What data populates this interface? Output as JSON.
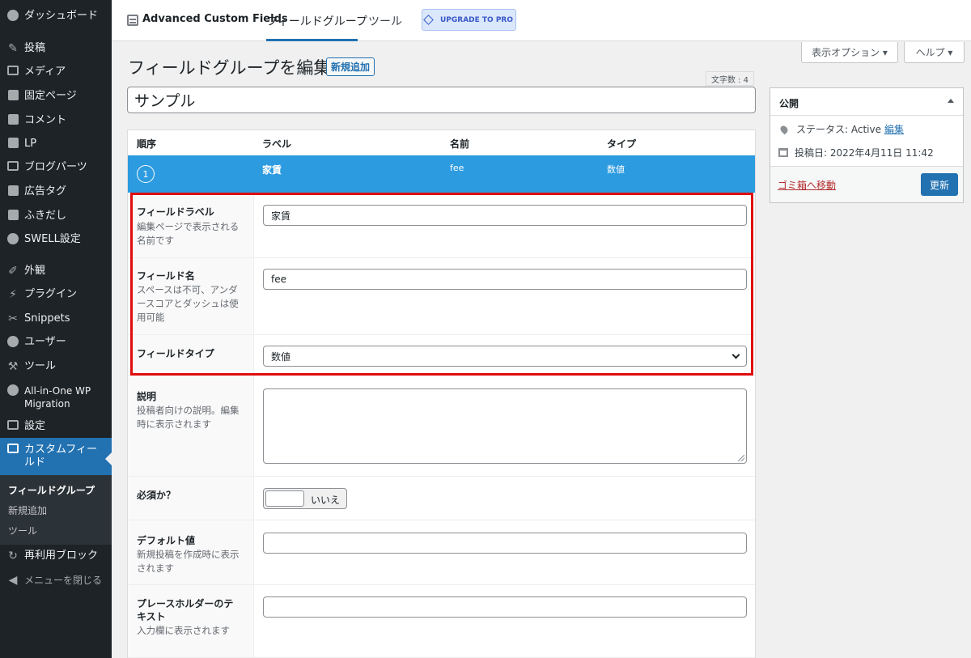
{
  "sidebar": {
    "items": [
      {
        "label": "ダッシュボード",
        "icon": "dashboard-icon"
      },
      {
        "label": "投稿",
        "icon": "pin-icon"
      },
      {
        "label": "メディア",
        "icon": "media-icon"
      },
      {
        "label": "固定ページ",
        "icon": "page-icon"
      },
      {
        "label": "コメント",
        "icon": "comment-icon"
      },
      {
        "label": "LP",
        "icon": "page-icon"
      },
      {
        "label": "ブログパーツ",
        "icon": "table-icon"
      },
      {
        "label": "広告タグ",
        "icon": "megaphone-icon"
      },
      {
        "label": "ふきだし",
        "icon": "speech-bubble-icon"
      },
      {
        "label": "SWELL設定",
        "icon": "swell-icon"
      },
      {
        "label": "外観",
        "icon": "brush-icon"
      },
      {
        "label": "プラグイン",
        "icon": "plugin-icon"
      },
      {
        "label": "Snippets",
        "icon": "scissors-icon"
      },
      {
        "label": "ユーザー",
        "icon": "user-icon"
      },
      {
        "label": "ツール",
        "icon": "wrench-icon"
      },
      {
        "label": "All-in-One WP Migration",
        "icon": "migration-icon"
      },
      {
        "label": "設定",
        "icon": "settings-icon"
      },
      {
        "label": "カスタムフィールド",
        "icon": "custom-fields-icon"
      }
    ],
    "submenu": [
      "フィールドグループ",
      "新規追加",
      "ツール"
    ],
    "reusable_blocks": "再利用ブロック",
    "collapse": "メニューを閉じる"
  },
  "header": {
    "plugin_name": "Advanced Custom Fields",
    "tabs": [
      "フィールドグループ",
      "ツール"
    ],
    "upgrade": "UPGRADE TO PRO"
  },
  "screen_options": {
    "display": "表示オプション ▾",
    "help": "ヘルプ ▾"
  },
  "page": {
    "title": "フィールドグループを編集",
    "add_new": "新規追加",
    "char_count": "文字数 : 4",
    "group_title": "サンプル"
  },
  "fields_table": {
    "headers": [
      "順序",
      "ラベル",
      "名前",
      "タイプ"
    ],
    "row": {
      "order": "1",
      "label": "家賃",
      "name": "fee",
      "type": "数値"
    }
  },
  "settings": {
    "label": {
      "title": "フィールドラベル",
      "desc": "編集ページで表示される名前です",
      "value": "家賃"
    },
    "name": {
      "title": "フィールド名",
      "desc": "スペースは不可、アンダースコアとダッシュは使用可能",
      "value": "fee"
    },
    "type": {
      "title": "フィールドタイプ",
      "value": "数値"
    },
    "instructions": {
      "title": "説明",
      "desc": "投稿者向けの説明。編集時に表示されます",
      "value": ""
    },
    "required": {
      "title": "必須か？",
      "toggle_label": "いいえ"
    },
    "default": {
      "title": "デフォルト値",
      "desc": "新規投稿を作成時に表示されます",
      "value": ""
    },
    "placeholder": {
      "title": "プレースホルダーのテキスト",
      "desc": "入力欄に表示されます",
      "value": ""
    }
  },
  "publish": {
    "title": "公開",
    "status_label": "ステータス: Active",
    "status_edit": "編集",
    "date_label": "投稿日: 2022年4月11日 11:42",
    "trash": "ゴミ箱へ移動",
    "update": "更新"
  },
  "colors": {
    "sidebar_bg": "#1d2327",
    "accent": "#2271b1",
    "field_row": "#2c9be0",
    "highlight": "#e00d0d"
  }
}
